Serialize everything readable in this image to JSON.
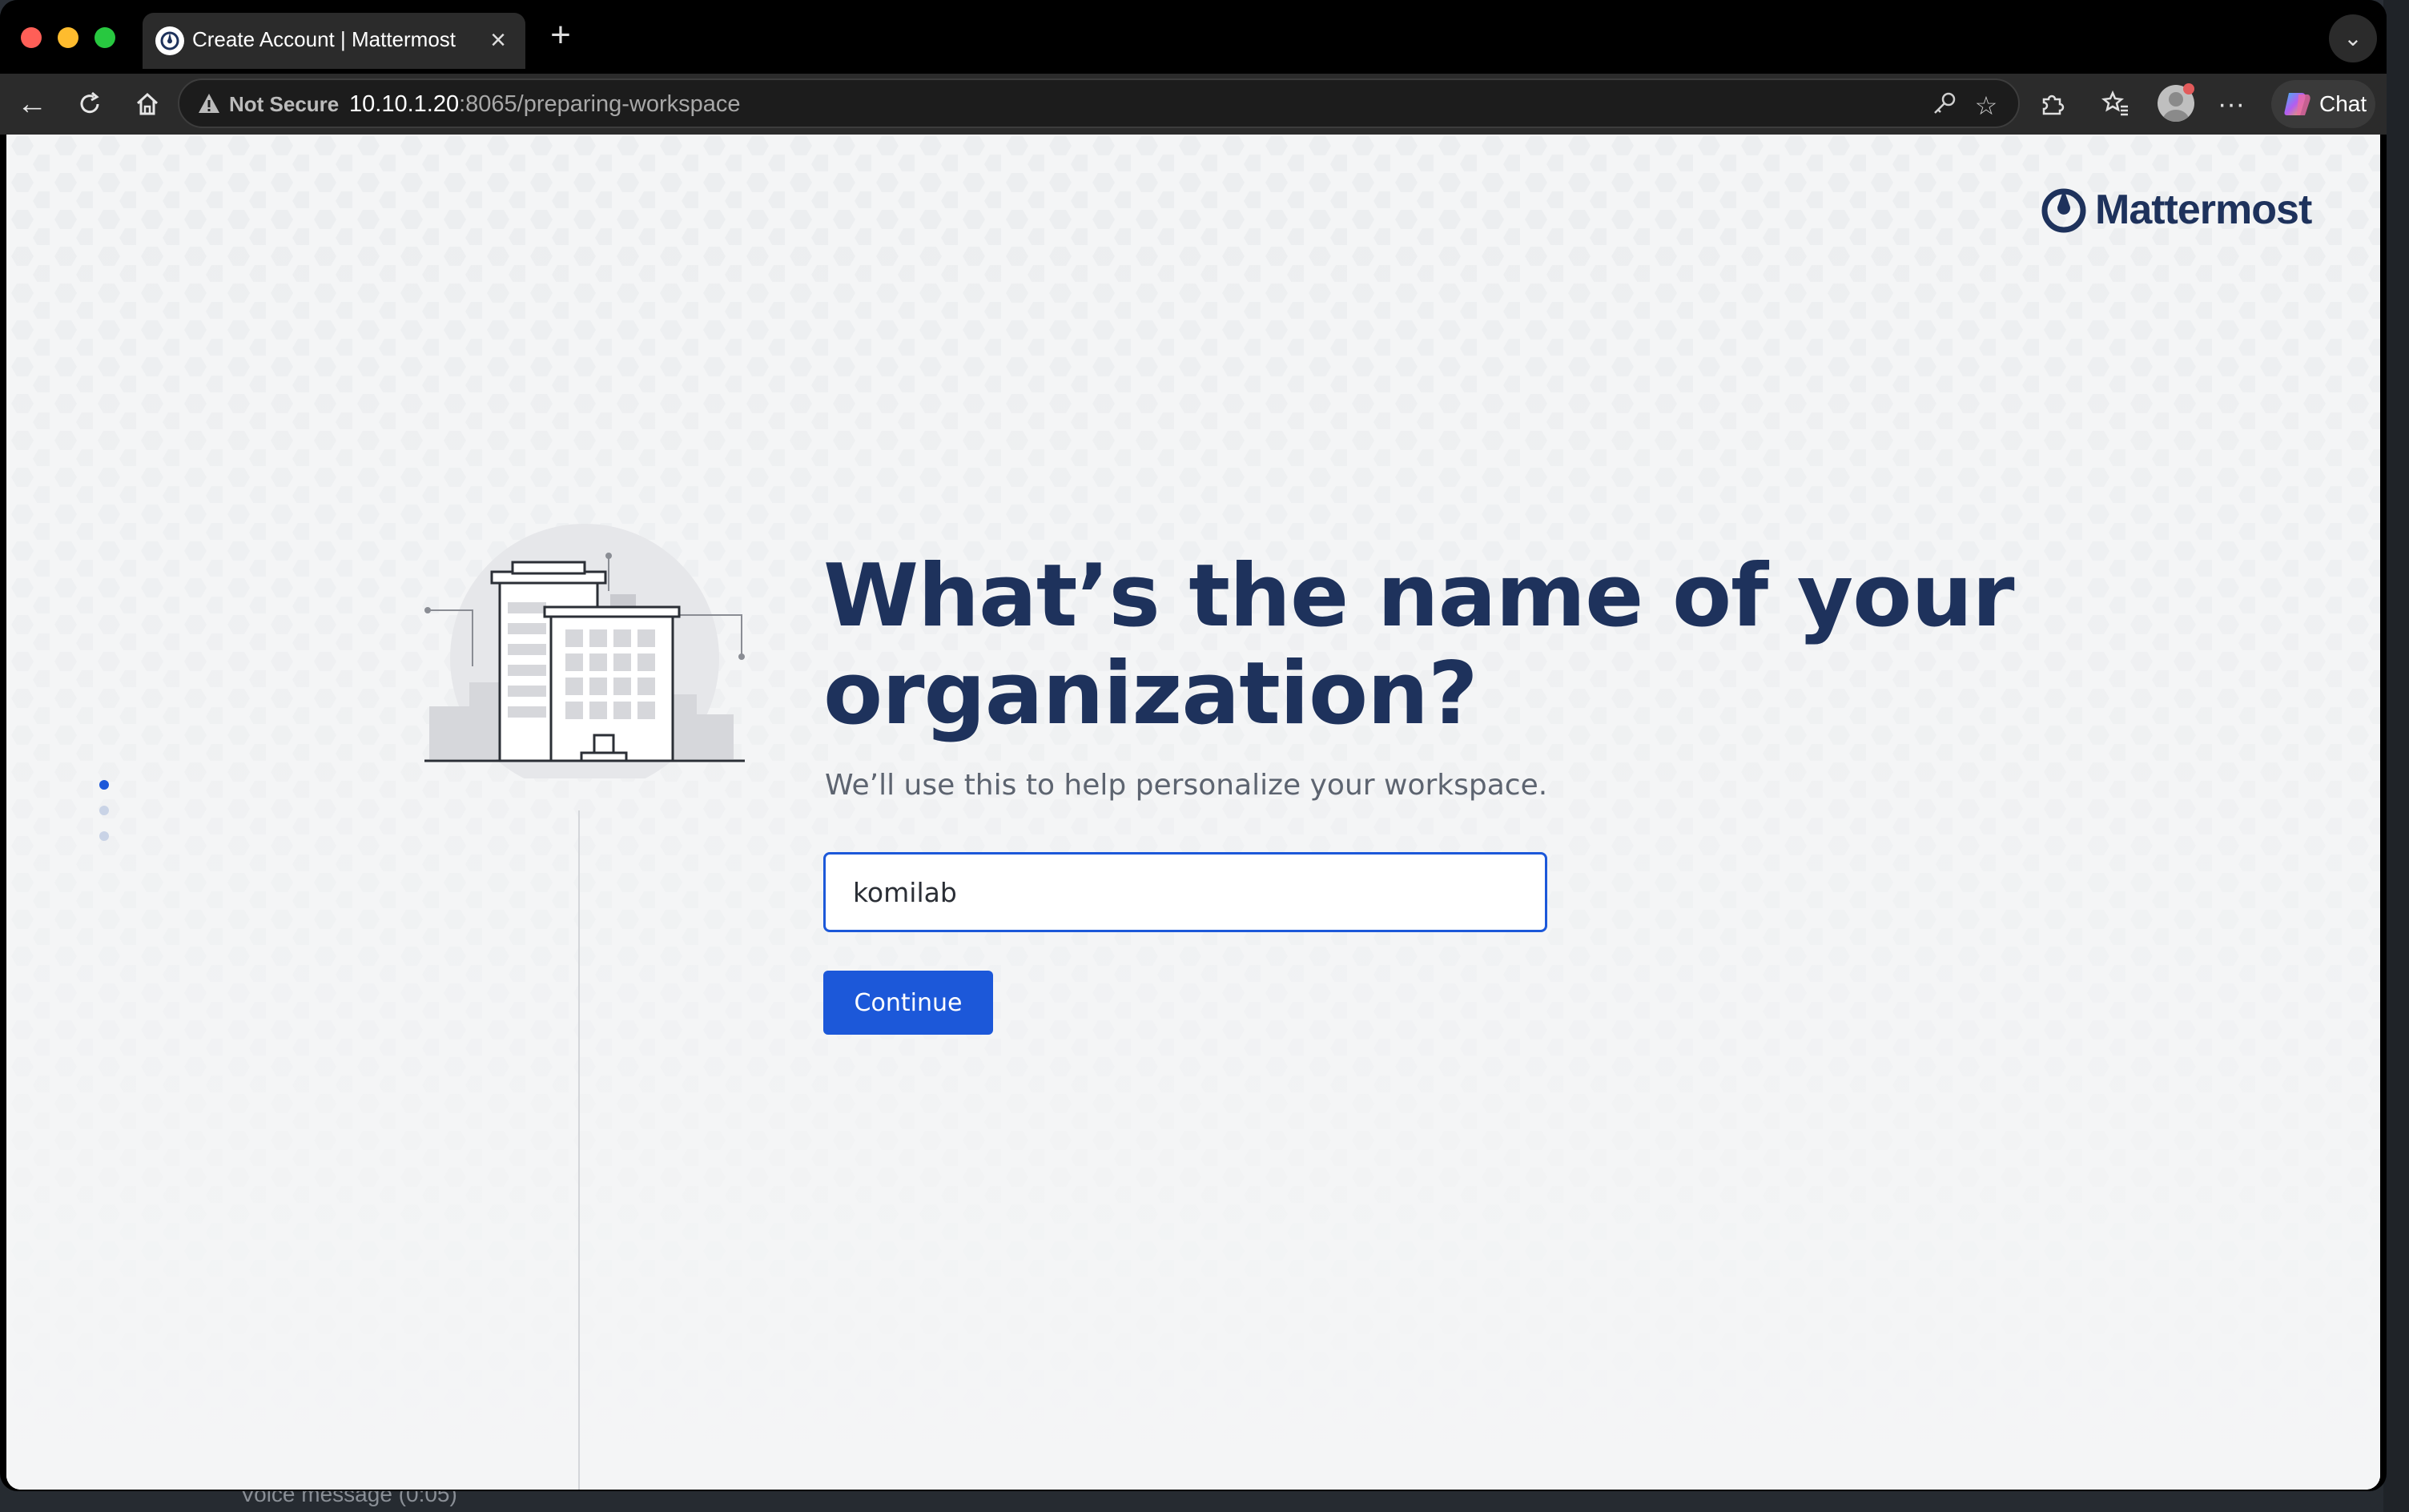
{
  "browser": {
    "tab_title": "Create Account | Mattermost",
    "security_label": "Not Secure",
    "url_host": "10.10.1.20",
    "url_rest": ":8065/preparing-workspace",
    "chat_label": "Chat"
  },
  "desktop": {
    "background_snippet": "Voice message (0:05)"
  },
  "page": {
    "brand": "Mattermost",
    "heading": "What’s the name of your organization?",
    "subtitle": "We’ll use this to help personalize your workspace.",
    "org_input_value": "komilab",
    "continue_label": "Continue",
    "progress_steps": 3,
    "progress_current": 1
  },
  "colors": {
    "brand_navy": "#1e325c",
    "primary_button": "#1c58d9",
    "page_bg": "#f4f5f6"
  },
  "icons": [
    "back-arrow-icon",
    "reload-icon",
    "home-icon",
    "warning-icon",
    "key-icon",
    "star-icon",
    "extensions-icon",
    "favorites-icon",
    "profile-icon",
    "more-icon",
    "copilot-icon",
    "close-icon",
    "plus-icon",
    "chevron-down-icon",
    "mattermost-logo-icon",
    "building-illustration"
  ]
}
